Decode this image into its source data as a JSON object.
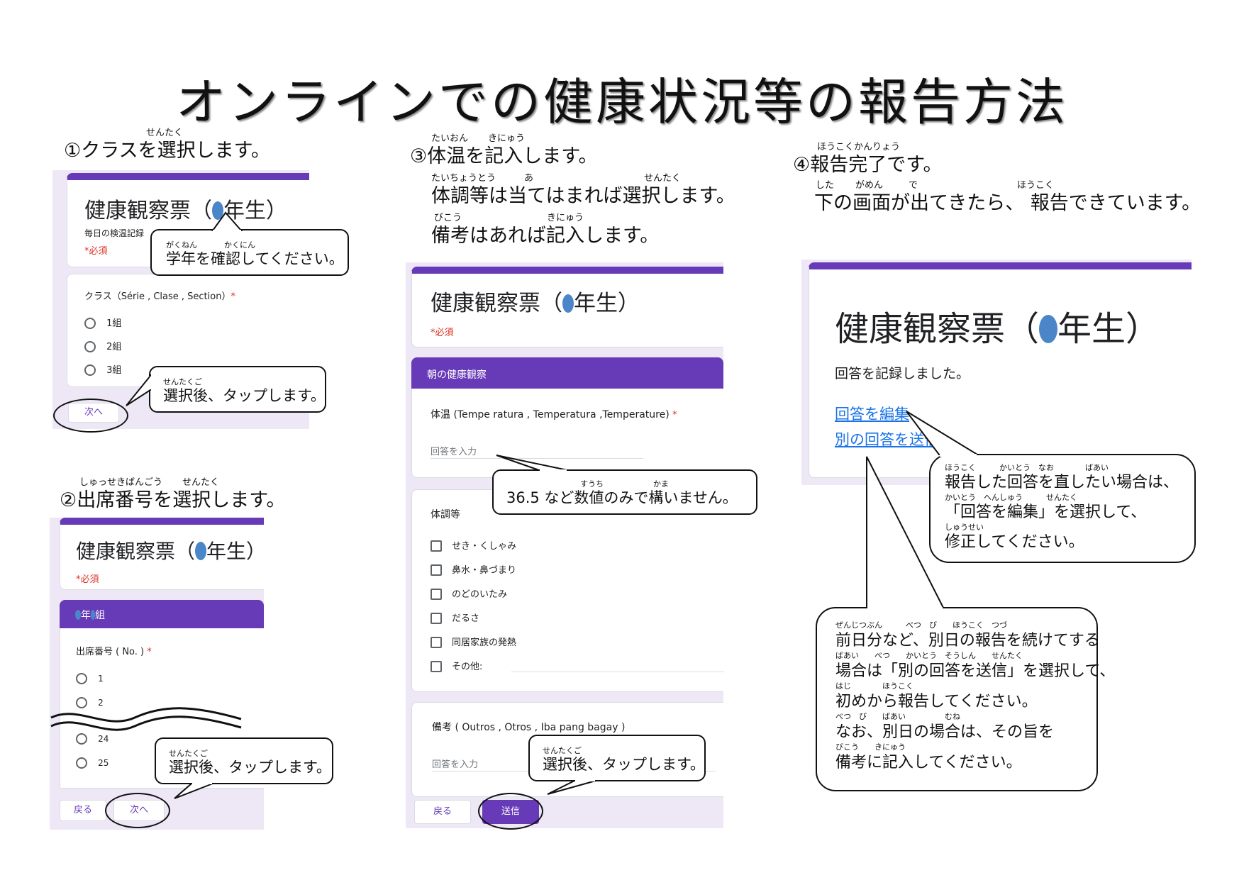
{
  "title": "オンラインでの健康状況等の報告方法",
  "steps": {
    "s1": "①クラスを選択します。",
    "s1_ruby": "せんたく",
    "s2": "②出席番号を選択します。",
    "s2_ruby1": "しゅっせきばんごう",
    "s2_ruby2": "せんたく",
    "s3": "③体温を記入します。",
    "s3_ruby1": "たいおん",
    "s3_ruby2": "きにゅう",
    "s3_line2": "体調等は当てはまれば選択します。",
    "s3_line2_ruby1": "たいちょうとう",
    "s3_line2_ruby2": "あ",
    "s3_line2_ruby3": "せんたく",
    "s3_line3": "備考はあれば記入します。",
    "s3_line3_ruby1": "びこう",
    "s3_line3_ruby2": "きにゅう",
    "s4": "④報告完了です。",
    "s4_ruby": "ほうこくかんりょう",
    "s4_line2": "下の画面が出てきたら、 報告できています。",
    "s4_line2_ruby1": "した",
    "s4_line2_ruby2": "がめん",
    "s4_line2_ruby3": "で",
    "s4_line2_ruby4": "ほうこく"
  },
  "form": {
    "title": "健康観察票（",
    "title_suffix": "年生）",
    "subtitle": "毎日の検温記録",
    "required": "*必須",
    "class_question": "クラス（Série , Clase , Section）",
    "asterisk": "*",
    "class_options": [
      "1組",
      "2組",
      "3組"
    ],
    "next": "次へ",
    "back": "戻る",
    "submit": "送信",
    "section_class": "年",
    "section_class_suffix": "組",
    "seat_question": "出席番号 ( No. )",
    "seat_options_top": [
      "1",
      "2"
    ],
    "seat_options_bottom": [
      "24",
      "25"
    ],
    "section_morning": "朝の健康観察",
    "temp_question": "体温 (Tempe ratura , Temperatura ,Temperature)",
    "answer_placeholder": "回答を入力",
    "condition_question": "体調等",
    "condition_options": [
      "せき・くしゃみ",
      "鼻水・鼻づまり",
      "のどのいたみ",
      "だるさ",
      "同居家族の発熱",
      "その他:"
    ],
    "notes_question": "備考 ( Outros , Otros , Iba pang bagay )",
    "recorded": "回答を記録しました。",
    "edit_link": "回答を編集",
    "another_link": "別の回答を送信"
  },
  "callouts": {
    "confirm_grade": "学年を確認してください。",
    "confirm_grade_ruby1": "がくねん",
    "confirm_grade_ruby2": "かくにん",
    "tap_after": "選択後、タップします。",
    "tap_after_ruby": "せんたくご",
    "temp_hint": "36.5 など数値のみで構いません。",
    "temp_hint_ruby1": "すうち",
    "temp_hint_ruby2": "かま",
    "edit_l1": "報告した回答を直したい場合は、",
    "edit_l1_ruby": "ほうこく　　　かいとう　なお　　　　ばあい",
    "edit_l2": "「回答を編集」を選択して、",
    "edit_l2_ruby": "かいとう　へんしゅう　　　せんたく",
    "edit_l3": "修正してください。",
    "edit_l3_ruby": "しゅうせい",
    "another_l1": "前日分など、別日の報告を続けてする",
    "another_l1_ruby": "ぜんじつぶん　　　べつ　び　　ほうこく　つづ",
    "another_l2": "場合は「別の回答を送信」を選択して、",
    "another_l2_ruby": "ばあい　　べつ　　かいとう　そうしん　　せんたく",
    "another_l3": "初めから報告してください。",
    "another_l3_ruby": "はじ　　　　ほうこく",
    "another_l4": "なお、別日の場合は、その旨を",
    "another_l4_ruby": "べつ　び　　ばあい　　　　　むね",
    "another_l5": "備考に記入してください。",
    "another_l5_ruby": "びこう　　きにゅう"
  },
  "colors": {
    "brand": "#673ab7",
    "lavender": "#ede7f6",
    "required": "#d93025",
    "link": "#1a73e8",
    "grade_dot": "#4a86c8"
  }
}
